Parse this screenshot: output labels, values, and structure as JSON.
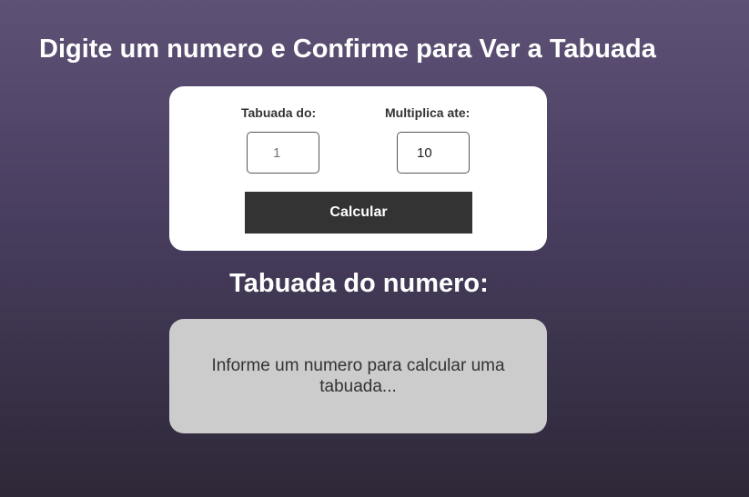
{
  "header": {
    "title": "Digite um numero e Confirme para Ver a Tabuada"
  },
  "form": {
    "tabuada_label": "Tabuada do:",
    "tabuada_placeholder": "1",
    "tabuada_value": "",
    "multiplica_label": "Multiplica ate:",
    "multiplica_value": "10",
    "calcular_label": "Calcular"
  },
  "result": {
    "title": "Tabuada do numero:",
    "message": "Informe um numero para calcular uma tabuada..."
  },
  "colors": {
    "background_top": "#5e5176",
    "background_bottom": "#2e2838",
    "card": "#ffffff",
    "button": "#333333",
    "result_card": "#cccccc"
  }
}
